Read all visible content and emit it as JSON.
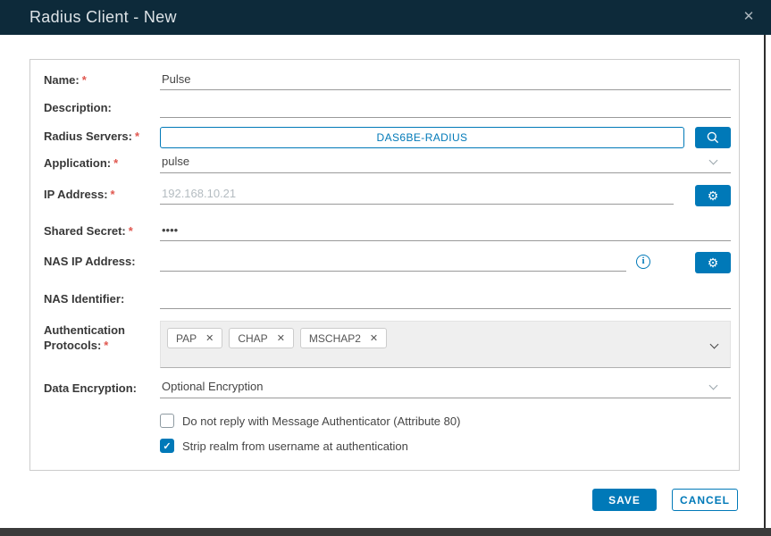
{
  "window": {
    "title": "Radius Client - New"
  },
  "icons": {
    "close": "✕",
    "gear": "⚙",
    "info": "i",
    "tag_remove": "✕",
    "check": "✓"
  },
  "form": {
    "name": {
      "label": "Name:",
      "required_marker": "*",
      "value": "Pulse"
    },
    "description": {
      "label": "Description:",
      "value": ""
    },
    "radius_servers": {
      "label": "Radius Servers:",
      "required_marker": "*",
      "value": "DAS6BE-RADIUS"
    },
    "application": {
      "label": "Application:",
      "required_marker": "*",
      "value": "pulse"
    },
    "ip_address": {
      "label": "IP Address:",
      "required_marker": "*",
      "value": "",
      "placeholder": "192.168.10.21"
    },
    "shared_secret": {
      "label": "Shared Secret:",
      "required_marker": "*",
      "value": "••••"
    },
    "nas_ip_address": {
      "label": "NAS IP Address:",
      "value": ""
    },
    "nas_identifier": {
      "label": "NAS Identifier:",
      "value": ""
    },
    "authentication_protocols": {
      "label_line1": "Authentication",
      "label_line2": "Protocols:",
      "required_marker": "*",
      "tags": [
        {
          "label": "PAP"
        },
        {
          "label": "CHAP"
        },
        {
          "label": "MSCHAP2"
        }
      ]
    },
    "data_encryption": {
      "label": "Data Encryption:",
      "value": "Optional Encryption"
    },
    "checkboxes": [
      {
        "label": "Do not reply with Message Authenticator (Attribute 80)",
        "checked": false
      },
      {
        "label": "Strip realm from username at authentication",
        "checked": true
      }
    ]
  },
  "footer": {
    "save_label": "SAVE",
    "cancel_label": "CANCEL"
  },
  "colors": {
    "accent_blue": "#0079b8",
    "header_bg": "#0d2a3a",
    "required_red": "#e0574f"
  }
}
